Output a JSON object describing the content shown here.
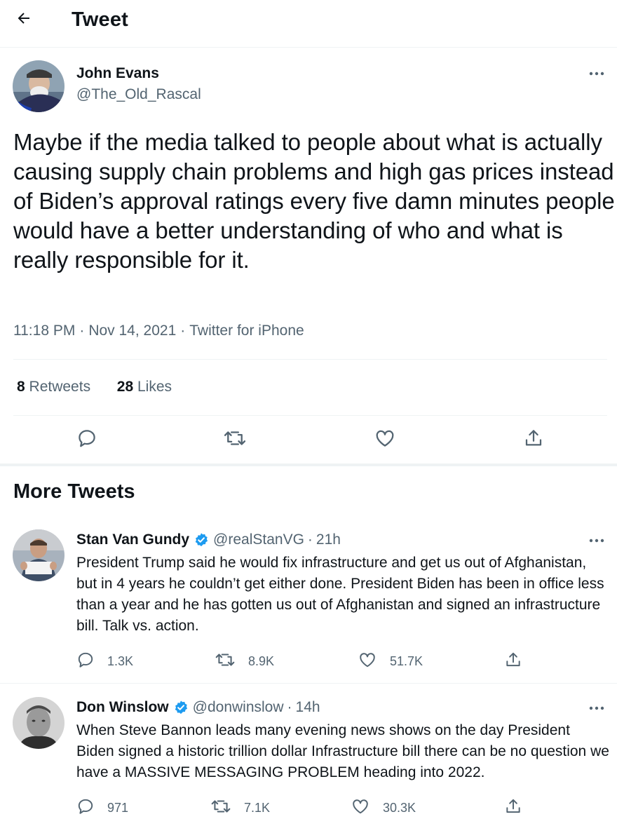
{
  "header": {
    "title": "Tweet",
    "back_icon": "arrow-left-icon"
  },
  "main_tweet": {
    "name": "John Evans",
    "handle": "@The_Old_Rascal",
    "text": "Maybe if the media talked to people about what is actually causing supply chain problems and high gas prices instead of Biden’s approval ratings every five damn minutes people would have a better understanding of who and what is really responsible for it.",
    "time": "11:18 PM",
    "date": "Nov 14, 2021",
    "source": "Twitter for iPhone",
    "separator": "·",
    "retweets_count": "8",
    "retweets_label": "Retweets",
    "likes_count": "28",
    "likes_label": "Likes"
  },
  "more_tweets": {
    "title": "More Tweets",
    "tweets": [
      {
        "name": "Stan Van Gundy",
        "handle": "@realStanVG",
        "dot": "·",
        "time": "21h",
        "text": "President Trump said he would fix infrastructure and get us out of Afghanistan, but in 4 years he couldn’t get either done. President Biden has been in office less than a year and he has gotten us out of Afghanistan and signed an infrastructure bill. Talk vs. action.",
        "replies": "1.3K",
        "retweets": "8.9K",
        "likes": "51.7K"
      },
      {
        "name": "Don Winslow",
        "handle": "@donwinslow",
        "dot": "·",
        "time": "14h",
        "text": "When Steve Bannon leads many evening news shows on the day President Biden signed a historic trillion dollar Infrastructure bill there can be no question we have a MASSIVE MESSAGING PROBLEM heading into 2022.",
        "replies": "971",
        "retweets": "7.1K",
        "likes": "30.3K"
      }
    ]
  },
  "colors": {
    "text": "#0f1419",
    "secondary": "#536471",
    "divider": "#eff3f4",
    "verified": "#1d9bf0"
  }
}
